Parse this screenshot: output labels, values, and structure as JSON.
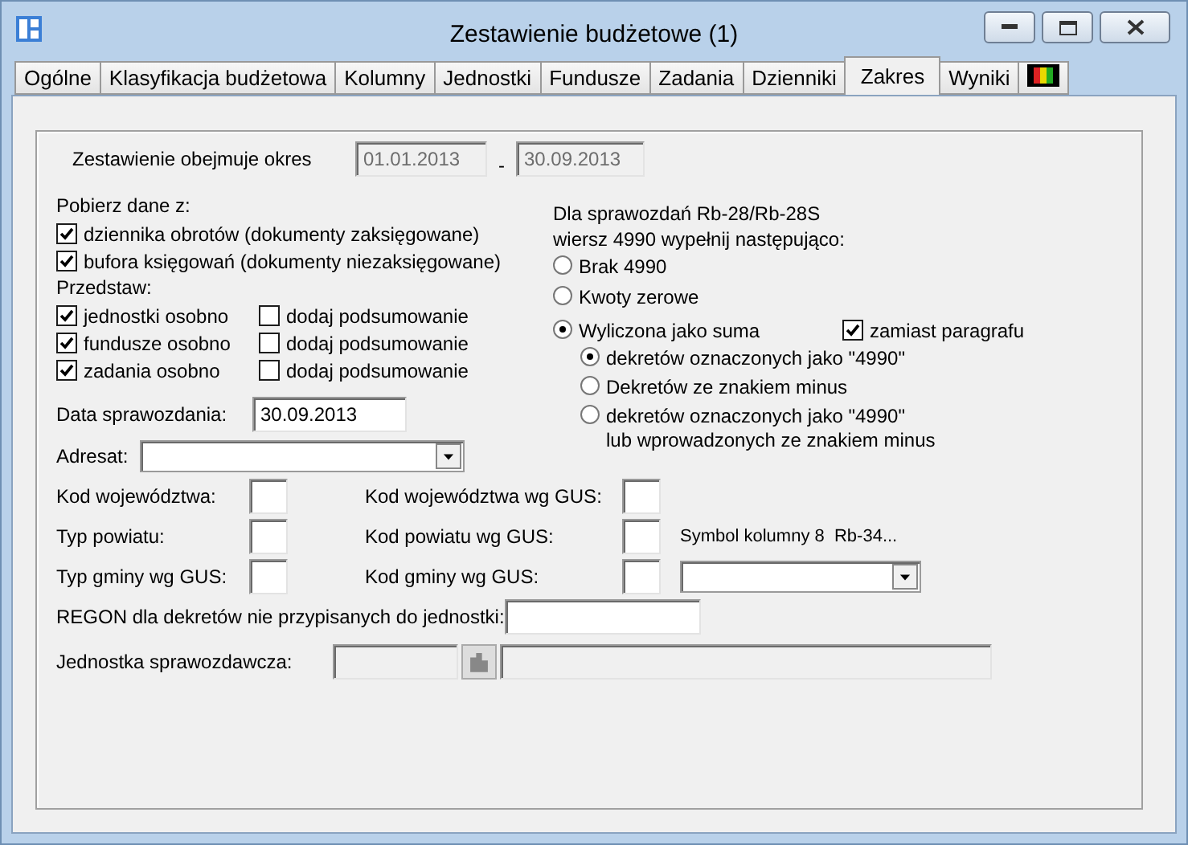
{
  "window": {
    "title": "Zestawienie budżetowe (1)"
  },
  "tabs": [
    {
      "kind": "text",
      "label": "Ogólne",
      "selected": false
    },
    {
      "kind": "text",
      "label": "Klasyfikacja budżetowa",
      "selected": false
    },
    {
      "kind": "text",
      "label": "Kolumny",
      "selected": false
    },
    {
      "kind": "text",
      "label": "Jednostki",
      "selected": false
    },
    {
      "kind": "text",
      "label": "Fundusze",
      "selected": false
    },
    {
      "kind": "text",
      "label": "Zadania",
      "selected": false
    },
    {
      "kind": "text",
      "label": "Dzienniki",
      "selected": false
    },
    {
      "kind": "text",
      "label": "Zakres",
      "selected": true
    },
    {
      "kind": "text",
      "label": "Wyniki",
      "selected": false
    },
    {
      "kind": "icon",
      "selected": false
    }
  ],
  "period": {
    "label": "Zestawienie obejmuje okres",
    "from": "01.01.2013",
    "separator": "-",
    "to": "30.09.2013"
  },
  "source": {
    "label": "Pobierz dane z:",
    "options": [
      {
        "label": "dziennika obrotów (dokumenty zaksięgowane)",
        "checked": true
      },
      {
        "label": "bufora księgowań (dokumenty niezaksięgowane)",
        "checked": true
      }
    ]
  },
  "present": {
    "label": "Przedstaw:",
    "rows": [
      {
        "label": "jednostki osobno",
        "checked": true,
        "summary": {
          "label": "dodaj podsumowanie",
          "checked": false
        }
      },
      {
        "label": "fundusze osobno",
        "checked": true,
        "summary": {
          "label": "dodaj podsumowanie",
          "checked": false
        }
      },
      {
        "label": "zadania osobno",
        "checked": true,
        "summary": {
          "label": "dodaj podsumowanie",
          "checked": false
        }
      }
    ]
  },
  "report_date": {
    "label": "Data sprawozdania:",
    "value": "30.09.2013"
  },
  "addressee": {
    "label": "Adresat:"
  },
  "rb28": {
    "heading": [
      "Dla sprawozdań Rb-28/Rb-28S",
      "wiersz 4990 wypełnij następująco:"
    ],
    "options": [
      {
        "label": "Brak 4990",
        "selected": false
      },
      {
        "label": "Kwoty zerowe",
        "selected": false
      },
      {
        "label": "Wyliczona jako suma",
        "selected": true
      }
    ],
    "instead": {
      "label": "zamiast paragrafu",
      "checked": true
    },
    "sub_options": [
      {
        "lines": [
          "dekretów oznaczonych jako \"4990\""
        ],
        "selected": true
      },
      {
        "lines": [
          "Dekretów ze znakiem minus"
        ],
        "selected": false
      },
      {
        "lines": [
          "dekretów oznaczonych jako \"4990\"",
          "lub wprowadzonych ze znakiem minus"
        ],
        "selected": false
      }
    ]
  },
  "codes": [
    {
      "left": "Kod województwa:",
      "right": "Kod województwa wg GUS:"
    },
    {
      "left": "Typ powiatu:",
      "right": "Kod powiatu wg GUS:",
      "extra": {
        "kind": "label",
        "text": "Symbol kolumny 8  Rb-34..."
      }
    },
    {
      "left": "Typ gminy wg GUS:",
      "right": "Kod gminy wg GUS:",
      "extra": {
        "kind": "dropdown"
      }
    }
  ],
  "regon": {
    "label": "REGON dla dekretów nie przypisanych do jednostki:"
  },
  "unit": {
    "label": "Jednostka sprawozdawcza:"
  }
}
